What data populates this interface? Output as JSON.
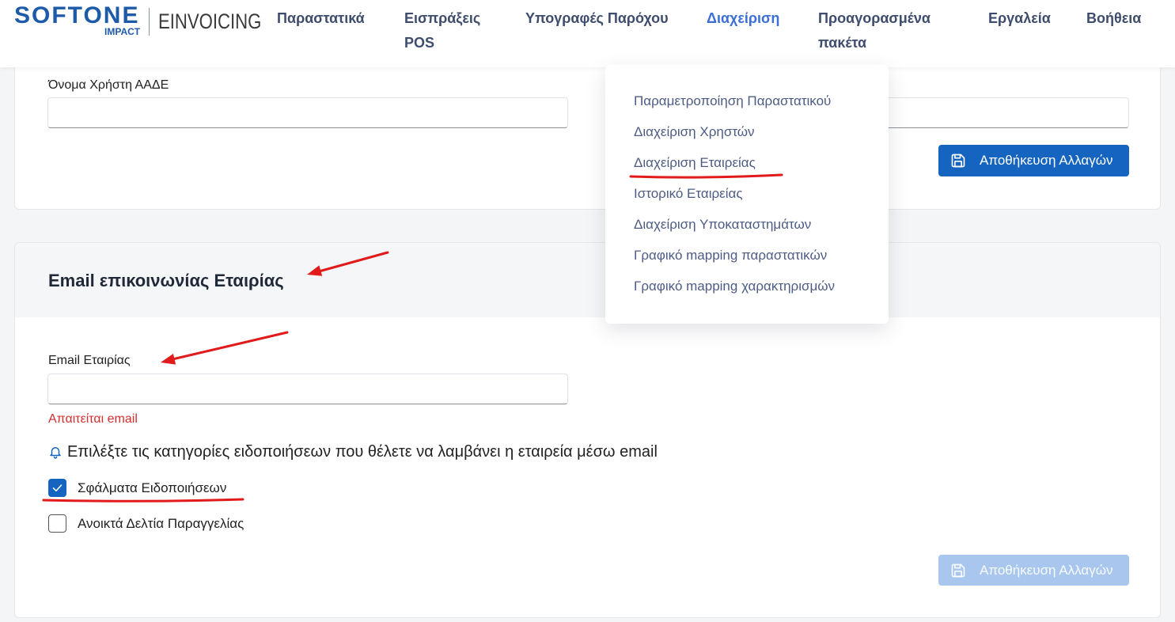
{
  "brand": {
    "name": "SOFTONE",
    "sub": "IMPACT",
    "product": "EINVOICING"
  },
  "nav": {
    "items": [
      {
        "label": "Παραστατικά",
        "active": false
      },
      {
        "label": "Εισπράξεις POS",
        "active": false
      },
      {
        "label": "Υπογραφές Παρόχου",
        "active": false
      },
      {
        "label": "Διαχείριση",
        "active": true
      },
      {
        "label": "Προαγορασμένα πακέτα",
        "active": false
      },
      {
        "label": "Εργαλεία",
        "active": false
      },
      {
        "label": "Βοήθεια",
        "active": false
      }
    ]
  },
  "menu": {
    "items": [
      {
        "label": "Παραμετροποίηση Παραστατικού"
      },
      {
        "label": "Διαχείριση Χρηστών"
      },
      {
        "label": "Διαχείριση Εταιρείας"
      },
      {
        "label": "Ιστορικό Εταιρείας"
      },
      {
        "label": "Διαχείριση Υποκαταστημάτων"
      },
      {
        "label": "Γραφικό mapping παραστατικών"
      },
      {
        "label": "Γραφικό mapping χαρακτηρισμών"
      }
    ]
  },
  "aade_card": {
    "username_label": "Όνομα Χρήστη ΑΑΔΕ",
    "username_value": "",
    "second_field_value": "",
    "save_label": "Αποθήκευση Αλλαγών"
  },
  "email_card": {
    "title": "Email επικοινωνίας Εταιρίας",
    "email_label": "Email Εταιρίας",
    "email_value": "",
    "error": "Απαιτείται email",
    "notify_prompt": "Επιλέξτε τις κατηγορίες ειδοποιήσεων που θέλετε να λαμβάνει η εταιρεία μέσω email",
    "options": [
      {
        "label": "Σφάλματα Ειδοποιήσεων",
        "checked": true
      },
      {
        "label": "Ανοικτά Δελτία Παραγγελίας",
        "checked": false
      }
    ],
    "save_label": "Αποθήκευση Αλλαγών",
    "save_disabled": true
  },
  "icons": {
    "save": "save-icon",
    "bell": "bell-icon",
    "check": "check-icon"
  },
  "colors": {
    "primary": "#1565c0",
    "brand": "#1d5aa8",
    "nav_text": "#3e4c6d",
    "nav_active": "#3a6fd8",
    "menu_text": "#4d5c83",
    "error": "#d32f2f",
    "annotation": "#e11b1b",
    "disabled_button": "#a9c7ee"
  }
}
